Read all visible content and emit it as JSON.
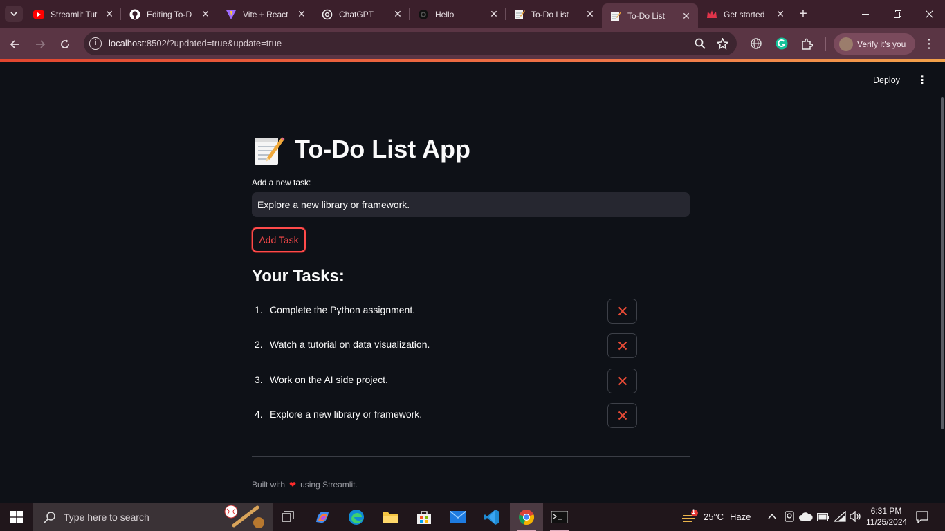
{
  "browser": {
    "tabs": [
      {
        "title": "Streamlit Tut",
        "icon": "youtube-icon"
      },
      {
        "title": "Editing To-D",
        "icon": "github-icon"
      },
      {
        "title": "Vite + React",
        "icon": "vite-icon"
      },
      {
        "title": "ChatGPT",
        "icon": "chatgpt-icon"
      },
      {
        "title": "Hello",
        "icon": "threads-icon"
      },
      {
        "title": "To-Do List",
        "icon": "memo-icon"
      },
      {
        "title": "To-Do List",
        "icon": "memo-icon",
        "active": true
      },
      {
        "title": "Get started",
        "icon": "crown-icon"
      }
    ],
    "url_host": "localhost",
    "url_rest": ":8502/?updated=true&update=true",
    "profile_label": "Verify it's you"
  },
  "app": {
    "deploy_label": "Deploy",
    "title": "To-Do List App",
    "title_icon": "memo-icon",
    "input_label": "Add a new task:",
    "input_value": "Explore a new library or framework.",
    "add_button_label": "Add Task",
    "tasks_heading": "Your Tasks:",
    "tasks": [
      {
        "num": "1.",
        "text": "Complete the Python assignment."
      },
      {
        "num": "2.",
        "text": "Watch a tutorial on data visualization."
      },
      {
        "num": "3.",
        "text": "Work on the AI side project."
      },
      {
        "num": "4.",
        "text": "Explore a new library or framework."
      }
    ],
    "footer_prefix": "Built with",
    "footer_heart": "❤",
    "footer_suffix": "using Streamlit."
  },
  "taskbar": {
    "search_placeholder": "Type here to search",
    "weather_temp": "25°C",
    "weather_desc": "Haze",
    "weather_badge": "1",
    "time": "6:31 PM",
    "date": "11/25/2024"
  },
  "colors": {
    "accent": "#ff4b4b",
    "page_bg": "#0e1117",
    "input_bg": "#262730",
    "chrome_frame": "#3b1f2b",
    "chrome_toolbar": "#5a3544"
  }
}
